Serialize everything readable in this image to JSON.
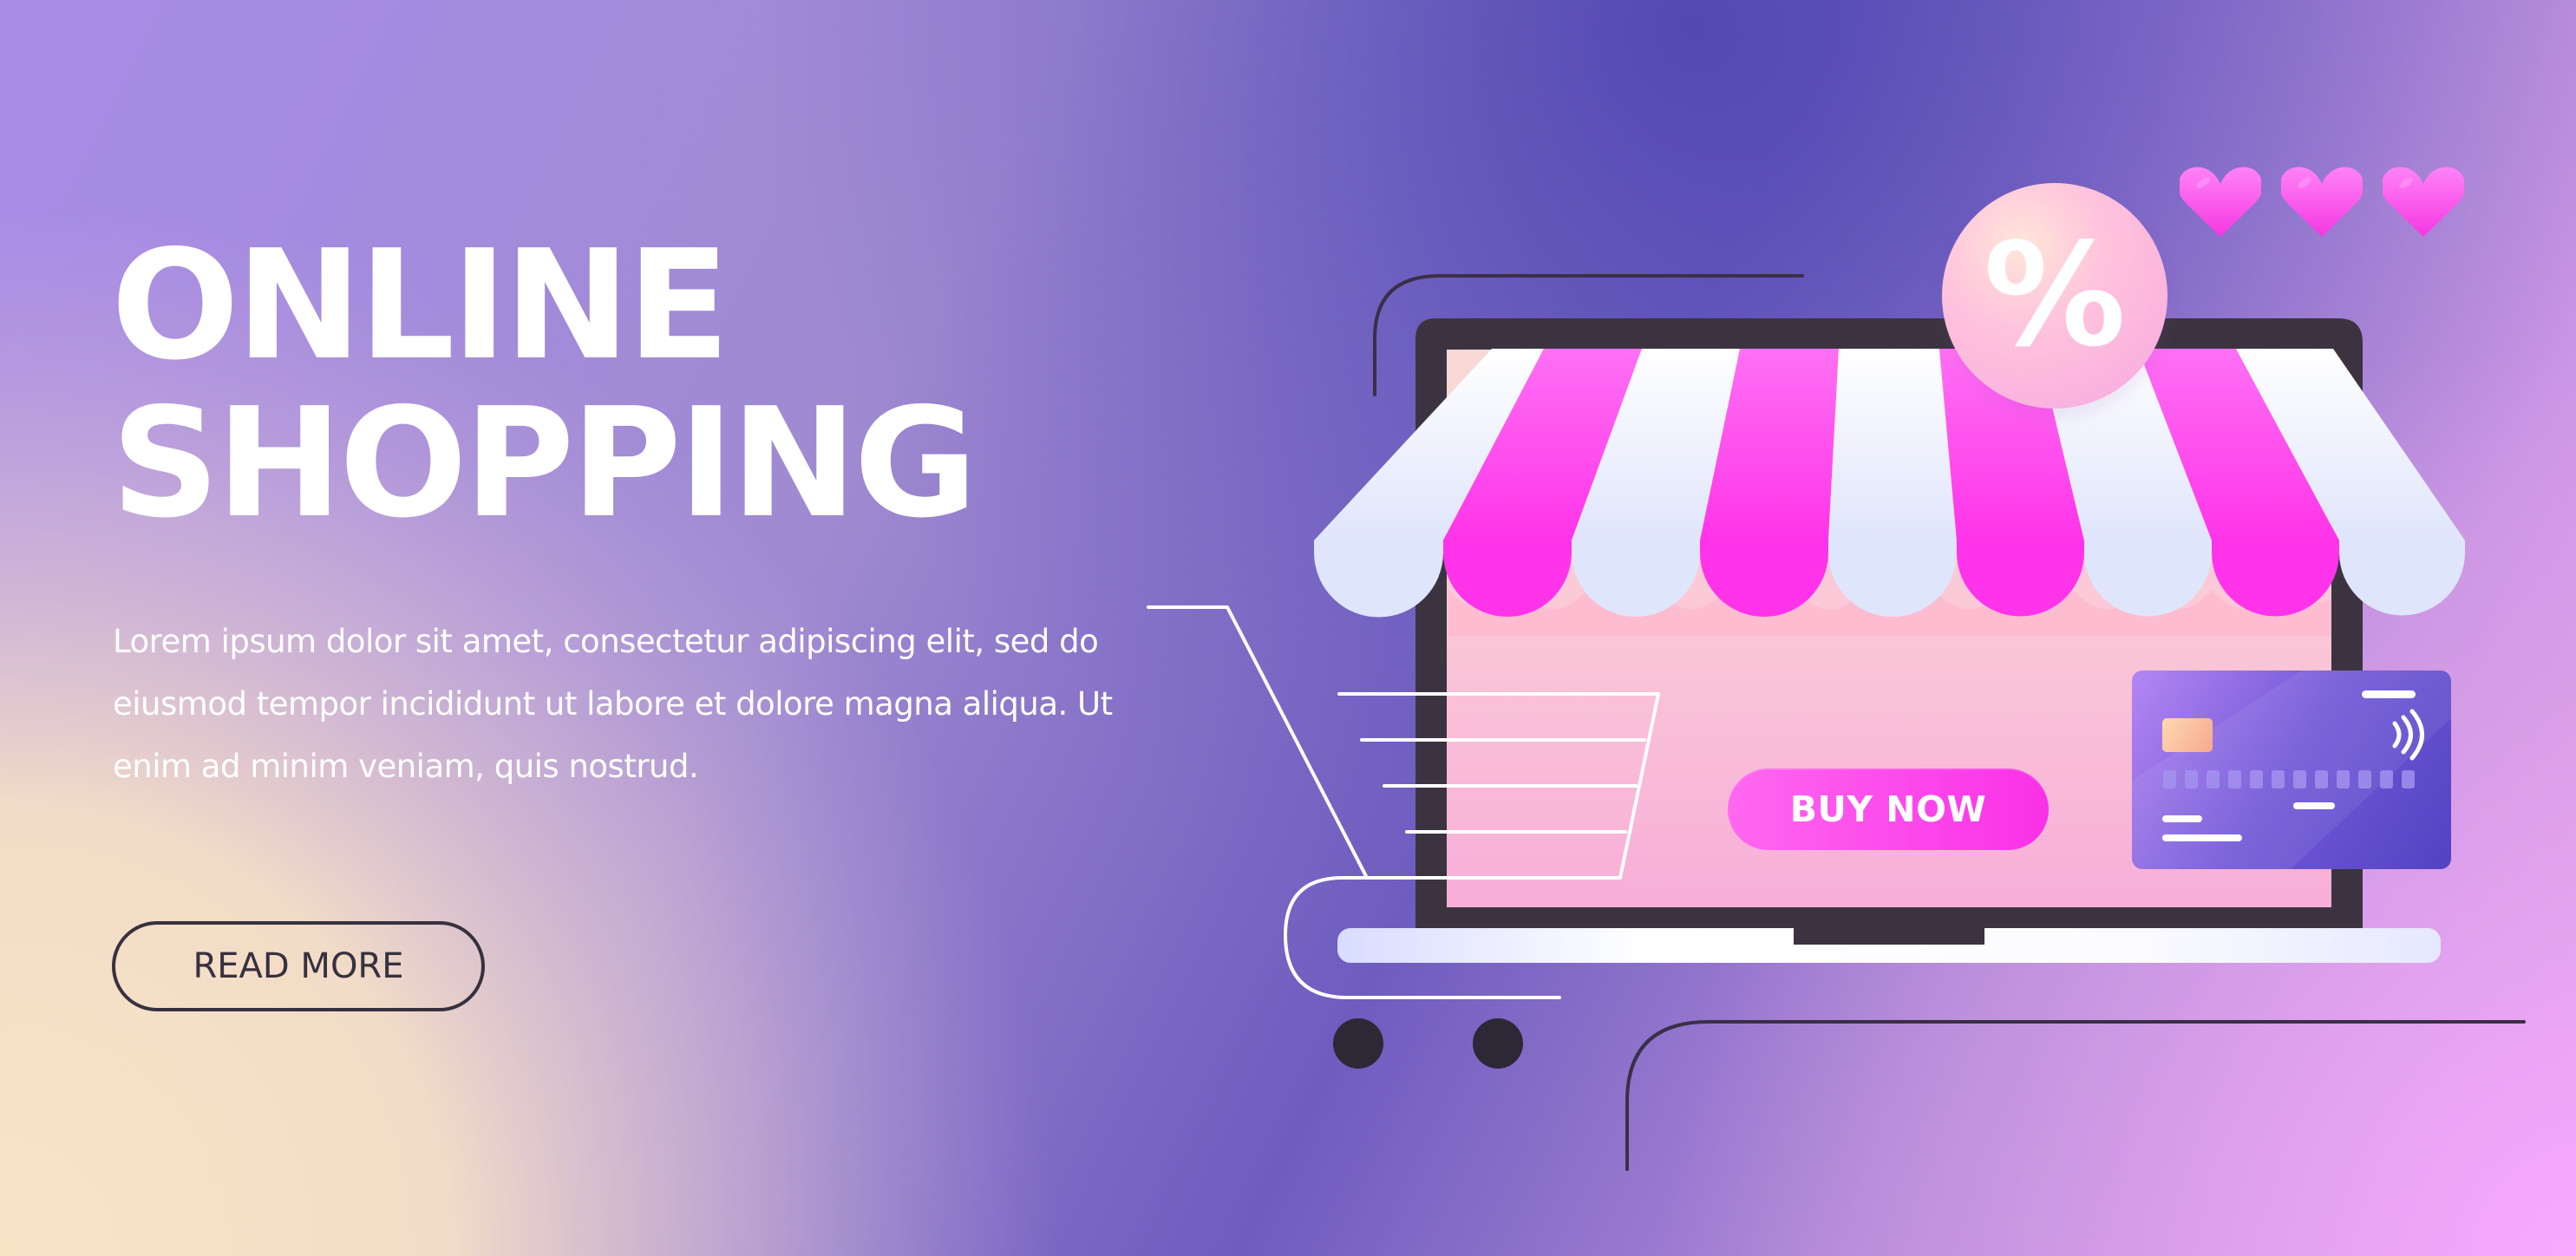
{
  "hero": {
    "title_line_1": "ONLINE",
    "title_line_2": "SHOPPING",
    "body": "Lorem ipsum dolor sit amet, consectetur adipiscing elit, sed do eiusmod tempor incididunt ut labore et dolore magna aliqua. Ut enim ad minim veniam, quis nostrud.",
    "read_more_label": "READ MORE"
  },
  "store": {
    "buy_now_label": "BUY NOW",
    "badge_symbol": "%"
  },
  "colors": {
    "white": "#ffffff",
    "charcoal": "#37313f",
    "magenta": "#f930e7",
    "violet": "#6b51c9",
    "card_violet": "#6a50cd"
  },
  "icons": [
    "heart-icon",
    "percent-badge-icon",
    "shopping-cart-icon",
    "credit-card-icon",
    "laptop-storefront-icon",
    "store-awning-icon"
  ]
}
